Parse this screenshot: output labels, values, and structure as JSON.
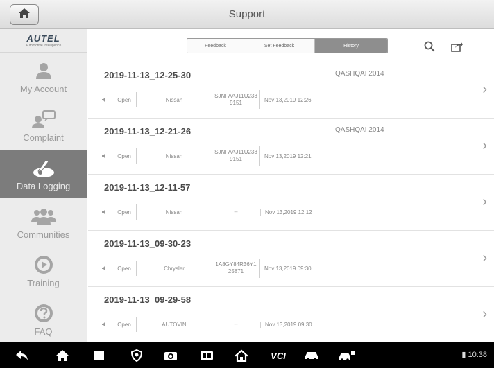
{
  "header": {
    "title": "Support"
  },
  "logo": {
    "name": "AUTEL",
    "tagline": "Automotive Intelligence"
  },
  "sidebar": {
    "items": [
      {
        "label": "My Account",
        "icon": "person-icon"
      },
      {
        "label": "Complaint",
        "icon": "complaint-icon"
      },
      {
        "label": "Data Logging",
        "icon": "data-logging-icon",
        "active": true
      },
      {
        "label": "Communities",
        "icon": "group-icon"
      },
      {
        "label": "Training",
        "icon": "play-icon"
      },
      {
        "label": "FAQ",
        "icon": "question-icon"
      }
    ]
  },
  "tabs": {
    "feedback": "Feedback",
    "set_feedback": "Set Feedback",
    "history": "History"
  },
  "records": [
    {
      "title": "2019-11-13_12-25-30",
      "model": "QASHQAI 2014",
      "status": "Open",
      "make": "Nissan",
      "vin": "SJNFAAJ11U2339151",
      "date": "Nov 13,2019 12:26"
    },
    {
      "title": "2019-11-13_12-21-26",
      "model": "QASHQAI 2014",
      "status": "Open",
      "make": "Nissan",
      "vin": "SJNFAAJ11U2339151",
      "date": "Nov 13,2019 12:21"
    },
    {
      "title": "2019-11-13_12-11-57",
      "model": "",
      "status": "Open",
      "make": "Nissan",
      "vin": "--",
      "date": "Nov 13,2019 12:12"
    },
    {
      "title": "2019-11-13_09-30-23",
      "model": "",
      "status": "Open",
      "make": "Chrysler",
      "vin": "1A8GY84R36Y125871",
      "date": "Nov 13,2019 09:30"
    },
    {
      "title": "2019-11-13_09-29-58",
      "model": "",
      "status": "Open",
      "make": "AUTOVIN",
      "vin": "--",
      "date": "Nov 13,2019 09:30"
    }
  ],
  "navbar": {
    "vci_label": "VCI",
    "clock": "10:38"
  },
  "colors": {
    "active_nav": "#7c7c7c",
    "titlebar": "#dcdcdc",
    "navbar": "#000000"
  }
}
